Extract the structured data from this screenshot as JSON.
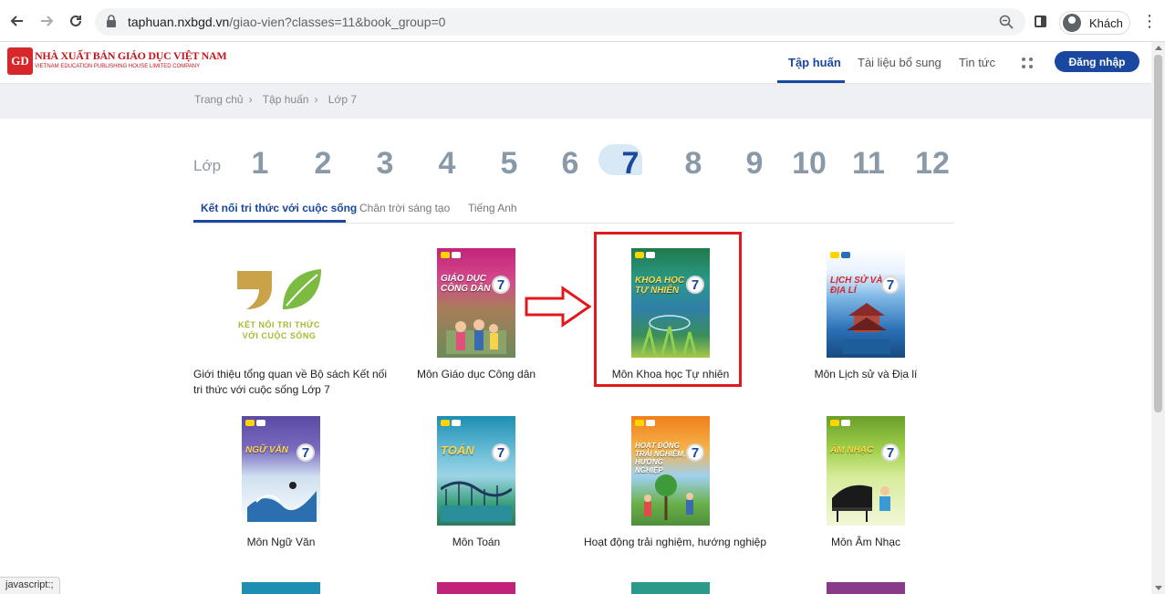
{
  "browser": {
    "url_host": "taphuan.nxbgd.vn",
    "url_path": "/giao-vien?classes=11&book_group=0",
    "profile_name": "Khách",
    "status_text": "javascript:;"
  },
  "site": {
    "logo_mark": "GD",
    "logo_line1": "NHÀ XUẤT BẢN GIÁO DỤC VIỆT NAM",
    "logo_line2": "VIETNAM EDUCATION PUBLISHING HOUSE LIMITED COMPANY",
    "nav": [
      {
        "label": "Tập huấn",
        "active": true
      },
      {
        "label": "Tài liệu bổ sung",
        "active": false
      },
      {
        "label": "Tin tức",
        "active": false
      }
    ],
    "login_label": "Đăng nhập",
    "accent_color": "#1a47a0"
  },
  "breadcrumb": [
    "Trang chủ",
    "Tập huấn",
    "Lớp 7"
  ],
  "grades": {
    "label": "Lớp",
    "items": [
      "1",
      "2",
      "3",
      "4",
      "5",
      "6",
      "7",
      "8",
      "9",
      "10",
      "11",
      "12"
    ],
    "selected": "7"
  },
  "series_tabs": [
    {
      "label": "Kết nối tri thức với cuộc sống",
      "active": true
    },
    {
      "label": "Chân trời sáng tạo",
      "active": false
    },
    {
      "label": "Tiếng Anh",
      "active": false
    }
  ],
  "intro_logo": {
    "line1": "KẾT NỐI TRI THỨC",
    "line2": "VỚI CUỘC SỐNG"
  },
  "books": [
    {
      "title": "Giới thiệu tổng quan về Bộ sách Kết nối tri thức với cuộc sống Lớp 7"
    },
    {
      "title": "Môn Giáo dục Công dân",
      "cover_text": "GIÁO DỤC CÔNG DÂN",
      "cover_color": "#c2237a"
    },
    {
      "title": "Môn Khoa học Tự nhiên",
      "cover_text": "KHOA HỌC TỰ NHIÊN",
      "cover_color": "#1f7a4a"
    },
    {
      "title": "Môn Lịch sử và Địa lí",
      "cover_text": "LỊCH SỬ VÀ ĐỊA LÍ",
      "cover_color": "#2a6fb5"
    },
    {
      "title": "Môn Ngữ Văn",
      "cover_text": "NGỮ VĂN",
      "cover_color": "#5b4aa3"
    },
    {
      "title": "Môn Toán",
      "cover_text": "TOÁN",
      "cover_color": "#1c8fb3"
    },
    {
      "title": "Hoạt động trải nghiệm, hướng nghiệp",
      "cover_text": "HOẠT ĐỘNG TRẢI NGHIỆM, HƯỚNG NGHIỆP",
      "cover_color": "#f07f1a"
    },
    {
      "title": "Môn Âm Nhạc",
      "cover_text": "ÂM NHẠC",
      "cover_color": "#6a9e2a"
    }
  ],
  "annotation_color": "#e1191d"
}
